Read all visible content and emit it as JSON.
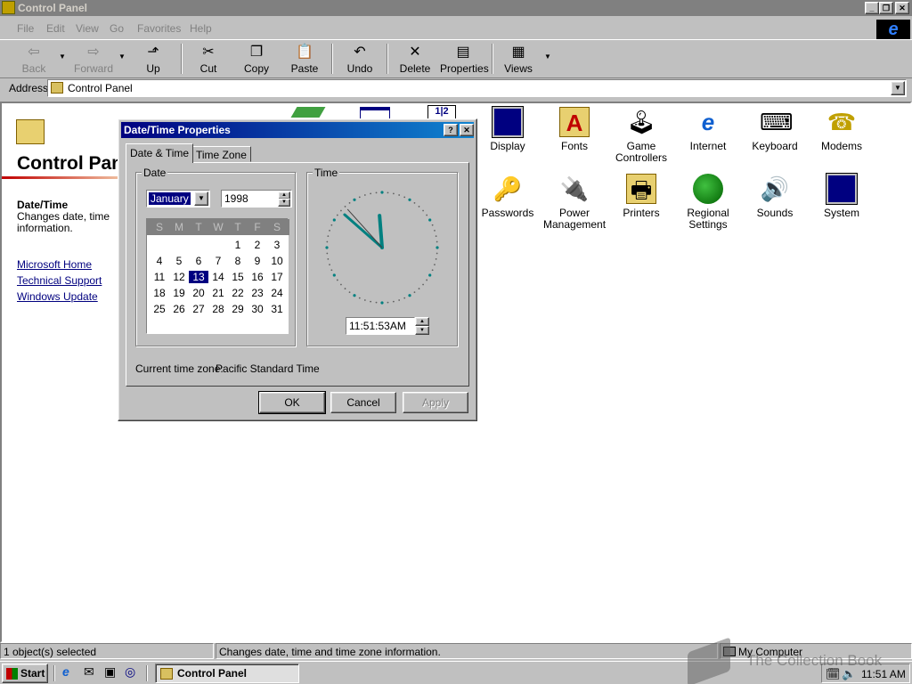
{
  "window": {
    "title": "Control Panel"
  },
  "menu": [
    "File",
    "Edit",
    "View",
    "Go",
    "Favorites",
    "Help"
  ],
  "toolbar": {
    "back": "Back",
    "forward": "Forward",
    "up": "Up",
    "cut": "Cut",
    "copy": "Copy",
    "paste": "Paste",
    "undo": "Undo",
    "delete": "Delete",
    "properties": "Properties",
    "views": "Views"
  },
  "address": {
    "label": "Address",
    "value": "Control Panel"
  },
  "left_pane": {
    "title": "Control Panel",
    "item_title": "Date/Time",
    "item_desc": "Changes date, time",
    "item_desc2": "information.",
    "links": [
      "Microsoft Home",
      "Technical Support",
      "Windows Update"
    ]
  },
  "icons": [
    {
      "label": "Display",
      "icon": "display-icon"
    },
    {
      "label": "Fonts",
      "icon": "fonts-icon"
    },
    {
      "label": "Game Controllers",
      "icon": "game-controllers-icon"
    },
    {
      "label": "Internet",
      "icon": "internet-icon"
    },
    {
      "label": "Keyboard",
      "icon": "keyboard-icon"
    },
    {
      "label": "Modems",
      "icon": "modems-icon"
    },
    {
      "label": "Passwords",
      "icon": "passwords-icon"
    },
    {
      "label": "Power Management",
      "icon": "power-management-icon"
    },
    {
      "label": "Printers",
      "icon": "printers-icon"
    },
    {
      "label": "Regional Settings",
      "icon": "regional-settings-icon"
    },
    {
      "label": "Sounds",
      "icon": "sounds-icon"
    },
    {
      "label": "System",
      "icon": "system-icon"
    }
  ],
  "dialog": {
    "title": "Date/Time Properties",
    "tabs": [
      "Date & Time",
      "Time Zone"
    ],
    "date_group": "Date",
    "time_group": "Time",
    "month": "January",
    "year": "1998",
    "weekdays": [
      "S",
      "M",
      "T",
      "W",
      "T",
      "F",
      "S"
    ],
    "calendar_rows": [
      [
        "",
        "",
        "",
        "",
        "1",
        "2",
        "3"
      ],
      [
        "4",
        "5",
        "6",
        "7",
        "8",
        "9",
        "10"
      ],
      [
        "11",
        "12",
        "13",
        "14",
        "15",
        "16",
        "17"
      ],
      [
        "18",
        "19",
        "20",
        "21",
        "22",
        "23",
        "24"
      ],
      [
        "25",
        "26",
        "27",
        "28",
        "29",
        "30",
        "31"
      ]
    ],
    "selected_day": "13",
    "time": "11:51:53AM",
    "clock": {
      "hour": 11,
      "minute": 51,
      "second": 53
    },
    "timezone_label": "Current time zone:",
    "timezone_value": "Pacific Standard Time",
    "ok": "OK",
    "cancel": "Cancel",
    "apply": "Apply"
  },
  "statusbar": {
    "left": "1 object(s) selected",
    "middle": "Changes date, time and time zone information.",
    "right": "My Computer"
  },
  "taskbar": {
    "start": "Start",
    "task": "Control Panel",
    "clock": "11:51 AM"
  },
  "watermark": "The Collection Book"
}
